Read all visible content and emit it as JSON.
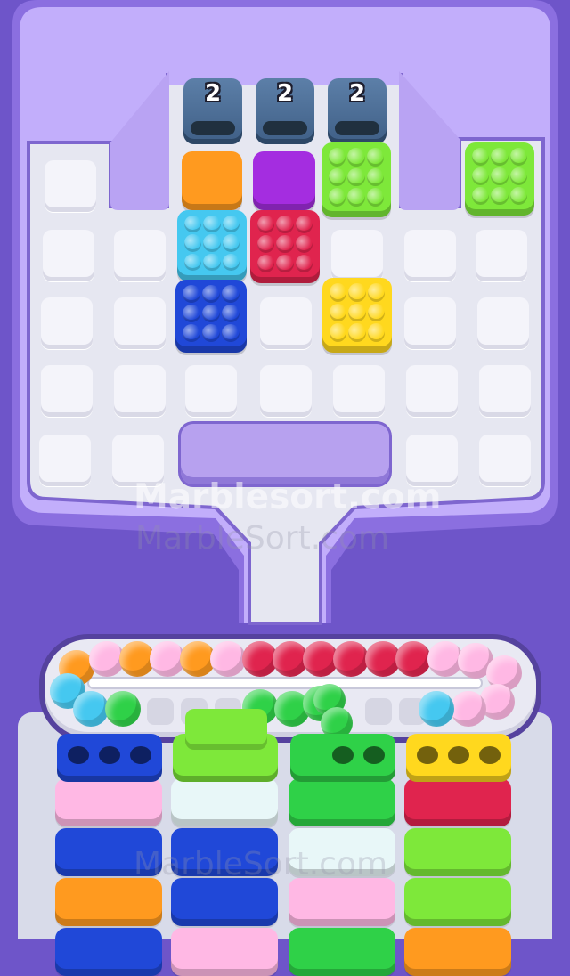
{
  "tunnels": [
    {
      "count": "2"
    },
    {
      "count": "2"
    },
    {
      "count": "2"
    }
  ],
  "watermark": {
    "primary": "Marblesort.com",
    "secondary": "MarbleSort.com",
    "bottom": "MarbleSort.com"
  },
  "colors": {
    "background": "#6e55c9",
    "tray": "#c2aefb",
    "board": "#e9e9f2",
    "orange": "#ff9a1f",
    "purple": "#a42de0",
    "lime": "#7ee83a",
    "cyan": "#45c8f0",
    "red": "#e0244e",
    "blue": "#2048d8",
    "yellow": "#ffd81e",
    "pink": "#ffb8e4",
    "green": "#2fd148",
    "white": "#e8f7f8"
  },
  "board_blocks": [
    {
      "name": "orange-block",
      "color": "orange",
      "studs": false
    },
    {
      "name": "purple-block",
      "color": "purple",
      "studs": false
    },
    {
      "name": "lime-block-top",
      "color": "lime",
      "studs": true
    },
    {
      "name": "lime-block-right",
      "color": "lime",
      "studs": true
    },
    {
      "name": "cyan-block",
      "color": "cyan",
      "studs": true
    },
    {
      "name": "red-block",
      "color": "red",
      "studs": true
    },
    {
      "name": "blue-block",
      "color": "blue",
      "studs": true
    },
    {
      "name": "yellow-block",
      "color": "yellow",
      "studs": true
    }
  ],
  "conveyor_marbles": [
    "orange",
    "pink",
    "orange",
    "pink",
    "orange",
    "pink",
    "red",
    "red",
    "red",
    "red",
    "red",
    "red",
    "pink",
    "pink",
    "pink",
    "pink",
    "pink",
    "cyan",
    "cyan",
    "cyan",
    "green",
    "green",
    "green",
    "green"
  ],
  "columns": [
    {
      "top": "blue",
      "holes": 3,
      "stack": [
        "pink",
        "blue",
        "orange",
        "blue"
      ]
    },
    {
      "top": "lime",
      "holes": 0,
      "stack": [
        "white",
        "blue",
        "blue",
        "pink"
      ]
    },
    {
      "top": "green",
      "holes": 2,
      "stack": [
        "green",
        "white",
        "pink",
        "green"
      ]
    },
    {
      "top": "yellow",
      "holes": 3,
      "stack": [
        "red",
        "lime",
        "lime",
        "orange"
      ]
    }
  ]
}
